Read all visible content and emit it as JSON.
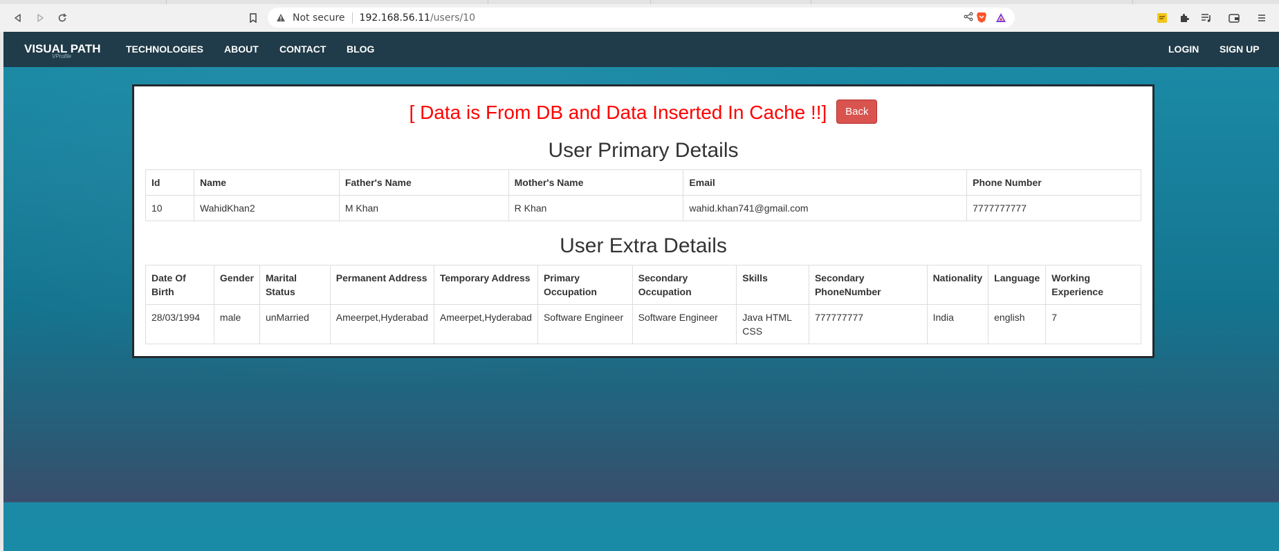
{
  "browser": {
    "not_secure_label": "Not secure",
    "url_host": "192.168.56.11",
    "url_path": "/users/10"
  },
  "navbar": {
    "brand": "VISUAL PATH",
    "brand_sub": "VProfile",
    "links": [
      "TECHNOLOGIES",
      "ABOUT",
      "CONTACT",
      "BLOG"
    ],
    "login": "LOGIN",
    "signup": "SIGN UP"
  },
  "card": {
    "headline": "[ Data is From DB and Data Inserted In Cache !!]",
    "back_label": "Back",
    "primary_title": "User Primary Details",
    "extra_title": "User Extra Details"
  },
  "primary_table": {
    "headers": [
      "Id",
      "Name",
      "Father's Name",
      "Mother's Name",
      "Email",
      "Phone Number"
    ],
    "row": [
      "10",
      "WahidKhan2",
      "M Khan",
      "R Khan",
      "wahid.khan741@gmail.com",
      "7777777777"
    ]
  },
  "extra_table": {
    "headers": [
      "Date Of Birth",
      "Gender",
      "Marital Status",
      "Permanent Address",
      "Temporary Address",
      "Primary Occupation",
      "Secondary Occupation",
      "Skills",
      "Secondary PhoneNumber",
      "Nationality",
      "Language",
      "Working Experience"
    ],
    "row": [
      "28/03/1994",
      "male",
      "unMarried",
      "Ameerpet,Hyderabad",
      "Ameerpet,Hyderabad",
      "Software Engineer",
      "Software Engineer",
      "Java HTML CSS",
      "777777777",
      "India",
      "english",
      "7"
    ]
  },
  "colors": {
    "navbar_bg": "#203b49",
    "headline_red": "#ff0000",
    "back_button_bg": "#d9534f",
    "page_teal": "#1a8aa8"
  }
}
